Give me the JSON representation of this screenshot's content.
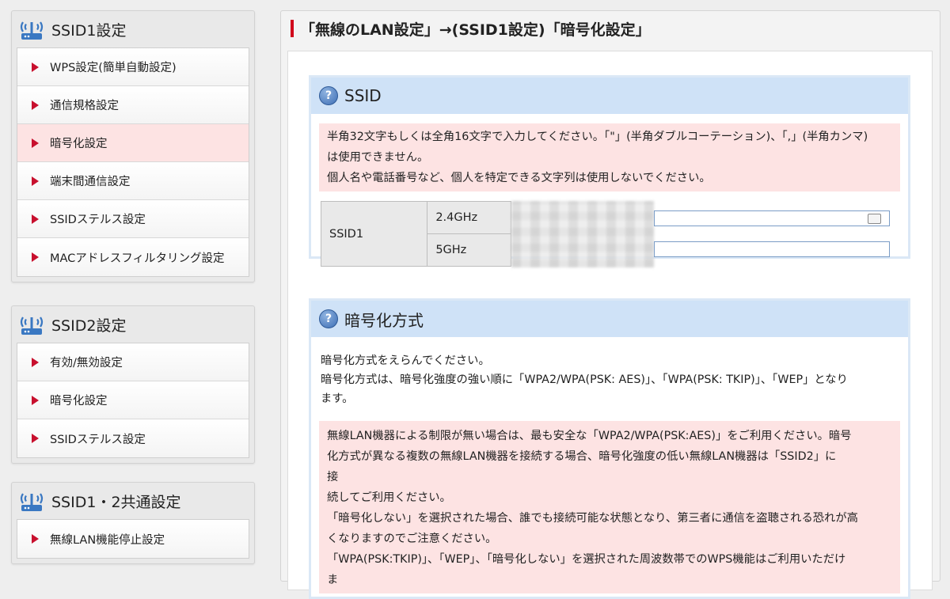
{
  "sidebar": {
    "panels": [
      {
        "title": "SSID1設定",
        "items": [
          {
            "label": "WPS設定(簡単自動設定)"
          },
          {
            "label": "通信規格設定"
          },
          {
            "label": "暗号化設定",
            "active": true
          },
          {
            "label": "端末間通信設定"
          },
          {
            "label": "SSIDステルス設定"
          },
          {
            "label": "MACアドレスフィルタリング設定"
          }
        ]
      },
      {
        "title": "SSID2設定",
        "items": [
          {
            "label": "有効/無効設定"
          },
          {
            "label": "暗号化設定"
          },
          {
            "label": "SSIDステルス設定"
          }
        ]
      },
      {
        "title": "SSID1・2共通設定",
        "items": [
          {
            "label": "無線LAN機能停止設定"
          }
        ]
      }
    ]
  },
  "main": {
    "title": "「無線のLAN設定」→(SSID1設定)「暗号化設定」",
    "ssid_section": {
      "header": "SSID",
      "notice_lines": [
        "半角32文字もしくは全角16文字で入力してください。「\"」(半角ダブルコーテーション)、「,」(半角カンマ)",
        "は使用できません。",
        "個人名や電話番号など、個人を特定できる文字列は使用しないでください。"
      ],
      "row_label": "SSID1",
      "bands": [
        "2.4GHz",
        "5GHz"
      ]
    },
    "encryption_section": {
      "header": "暗号化方式",
      "text_lines": [
        "暗号化方式をえらんでください。",
        "暗号化方式は、暗号化強度の強い順に「WPA2/WPA(PSK: AES)」、「WPA(PSK: TKIP)」、「WEP」となり",
        "ます。"
      ],
      "notice_lines": [
        "無線LAN機器による制限が無い場合は、最も安全な「WPA2/WPA(PSK:AES)」をご利用ください。暗号",
        "化方式が異なる複数の無線LAN機器を接続する場合、暗号化強度の低い無線LAN機器は「SSID2」に",
        "接",
        "続してご利用ください。",
        "「暗号化しない」を選択された場合、誰でも接続可能な状態となり、第三者に通信を盗聴される恐れが高",
        "くなりますのでご注意ください。",
        "「WPA(PSK:TKIP)」、「WEP」、「暗号化しない」を選択された周波数帯でのWPS機能はご利用いただけ",
        "ま"
      ]
    }
  },
  "colors": {
    "accent_red": "#d0021b",
    "active_item_bg": "#fde3e3",
    "section_header_bg": "#cfe2f7",
    "notice_bg": "#fde3e3"
  },
  "icons": [
    "wifi-router-icon",
    "triangle-arrow-icon",
    "question-icon",
    "card-icon"
  ]
}
